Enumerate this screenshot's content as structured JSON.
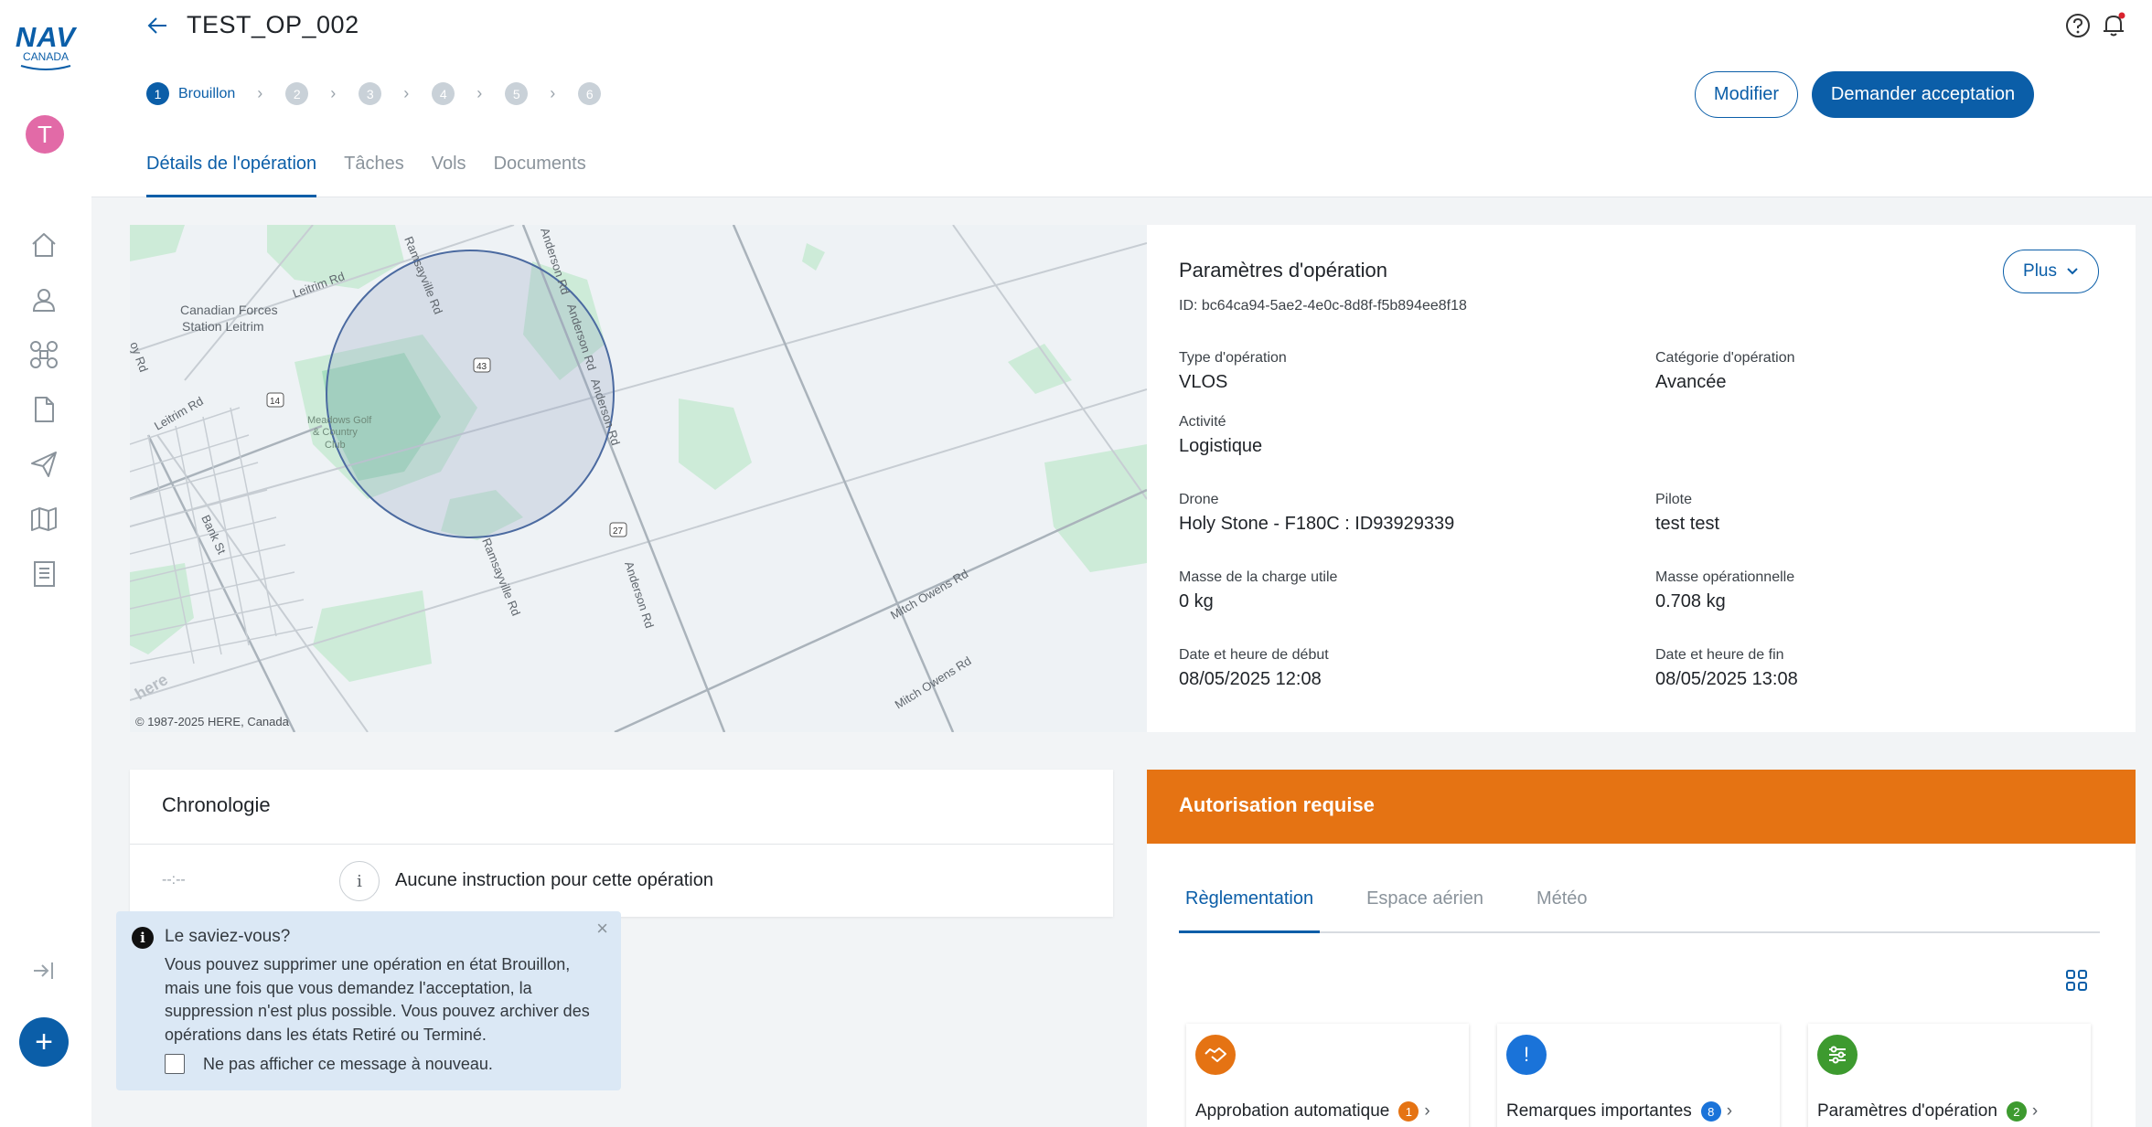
{
  "brand": {
    "logo_nav": "NAV",
    "logo_canada": "CANADA"
  },
  "user": {
    "avatar_initial": "T"
  },
  "sidebar": {
    "icons": [
      "home-icon",
      "user-icon",
      "drone-icon",
      "document-icon",
      "send-icon",
      "map-icon",
      "logbook-icon"
    ],
    "collapse_icon": "collapse-icon",
    "fab_label": "+"
  },
  "header": {
    "title": "TEST_OP_002",
    "stepper": [
      {
        "num": "1",
        "label": "Brouillon",
        "active": true
      },
      {
        "num": "2"
      },
      {
        "num": "3"
      },
      {
        "num": "4"
      },
      {
        "num": "5"
      },
      {
        "num": "6"
      }
    ],
    "modify_label": "Modifier",
    "request_label": "Demander acceptation",
    "tabs": [
      "Détails de l'opération",
      "Tâches",
      "Vols",
      "Documents"
    ],
    "active_tab": 0
  },
  "map": {
    "copyright": "© 1987-2025 HERE, Canada",
    "labels": {
      "cfs": "Canadian Forces",
      "cfs2": "Station Leitrim",
      "leitrim1": "Leitrim Rd",
      "leitrim2": "Leitrim Rd",
      "ramsay1": "Ramsayville Rd",
      "ramsay2": "Ramsayville Rd",
      "anderson1": "Anderson Rd",
      "anderson2": "Anderson Rd",
      "anderson3": "Anderson Rd",
      "anderson4": "Anderson Rd",
      "bank": "Bank St",
      "golf1": "Meadows Golf",
      "golf2": "& Country",
      "golf3": "Club",
      "mitch1": "Mitch Owens Rd",
      "mitch2": "Mitch Owens Rd",
      "hwy14": "14",
      "hwy43": "43",
      "hwy27": "27",
      "roy": "oy Rd",
      "here": "here"
    }
  },
  "params": {
    "title": "Paramètres d'opération",
    "id": "ID: bc64ca94-5ae2-4e0c-8d8f-f5b894ee8f18",
    "plus_label": "Plus",
    "fields": {
      "type_label": "Type d'opération",
      "type_value": "VLOS",
      "category_label": "Catégorie d'opération",
      "category_value": "Avancée",
      "activity_label": "Activité",
      "activity_value": "Logistique",
      "drone_label": "Drone",
      "drone_value": "Holy Stone - F180C : ID93929339",
      "pilot_label": "Pilote",
      "pilot_value": "test test",
      "payload_label": "Masse de la charge utile",
      "payload_value": "0 kg",
      "opmass_label": "Masse opérationnelle",
      "opmass_value": "0.708 kg",
      "start_label": "Date et heure de début",
      "start_value": "08/05/2025 12:08",
      "end_label": "Date et heure de fin",
      "end_value": "08/05/2025 13:08"
    }
  },
  "chronology": {
    "title": "Chronologie",
    "time": "--:--",
    "info_glyph": "i",
    "text": "Aucune instruction pour cette opération"
  },
  "tip": {
    "title": "Le saviez-vous?",
    "body": "Vous pouvez supprimer une opération en état Brouillon, mais une fois que vous demandez l'acceptation, la suppression n'est plus possible. Vous pouvez archiver des opérations dans les états Retiré ou Terminé.",
    "checkbox_label": "Ne pas afficher ce message à nouveau.",
    "close_glyph": "×",
    "info_glyph": "i"
  },
  "authorization": {
    "title": "Autorisation requise",
    "tabs": [
      "Règlementation",
      "Espace aérien",
      "Météo"
    ],
    "active_tab": 0,
    "cards": [
      {
        "label": "Approbation automatique",
        "count": "1",
        "icon": "handshake-icon",
        "color": "#e57313"
      },
      {
        "label": "Remarques importantes",
        "count": "8",
        "icon": "exclamation-icon",
        "color": "#1a73d9"
      },
      {
        "label": "Paramètres d'opération",
        "count": "2",
        "icon": "sliders-icon",
        "color": "#3d9a2f"
      }
    ]
  },
  "colors": {
    "primary": "#0b5ea8",
    "warning": "#e57313",
    "avatar": "#e26aa7"
  }
}
